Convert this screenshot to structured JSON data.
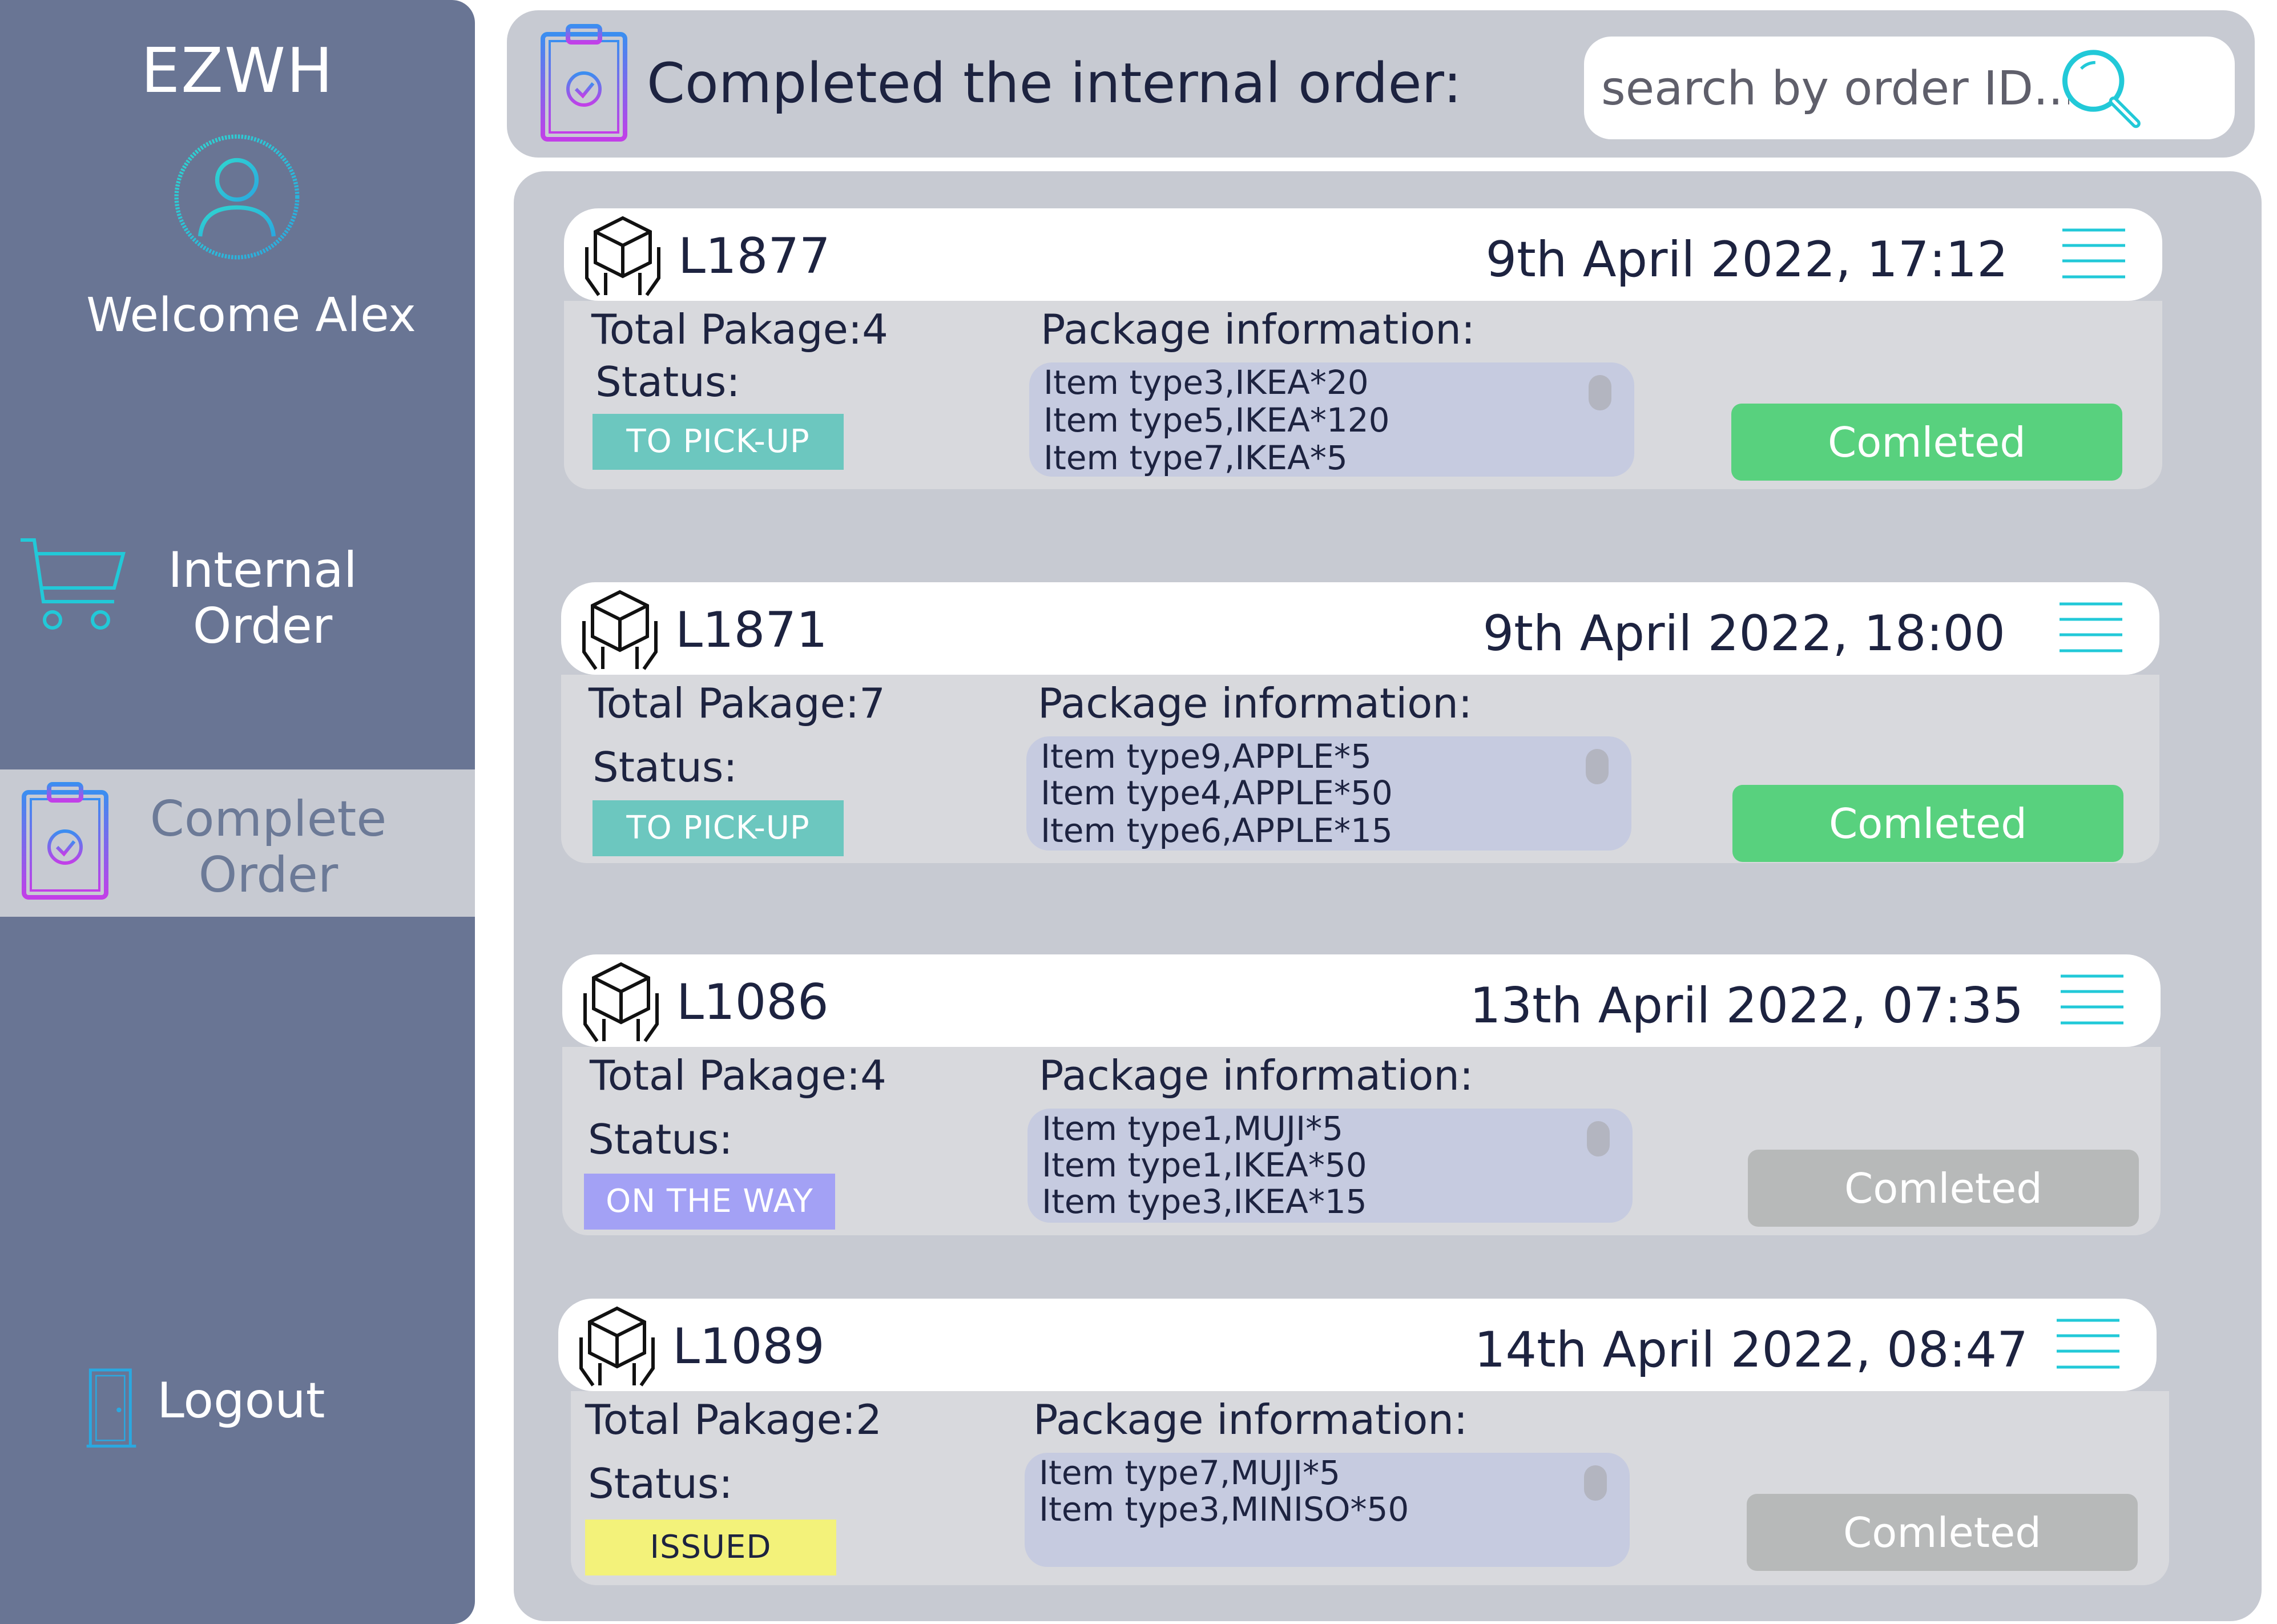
{
  "sidebar": {
    "brand": "EZWH",
    "welcome": "Welcome Alex",
    "avatar_icon": "user-circle-icon",
    "nav": {
      "internal": {
        "label": "Internal\nOrder",
        "icon": "cart-icon"
      },
      "complete": {
        "label": "Complete\nOrder",
        "icon": "clipboard-check-icon"
      },
      "logout": {
        "label": "Logout",
        "icon": "door-icon"
      }
    }
  },
  "header": {
    "title": "Completed the internal order:",
    "icon": "clipboard-check-icon",
    "search_placeholder": "search by order ID..."
  },
  "colors": {
    "sidebar": "#697594",
    "panel": "#c7cad2",
    "accent_cyan": "#22c9d8",
    "accent_purple": "#9b4fe6",
    "to_pickup": "#6cc7bf",
    "on_the_way": "#a3a1f5",
    "issued": "#f3f27a",
    "completed_active": "#58d17e",
    "completed_disabled": "#b7b9b9"
  },
  "orders": [
    {
      "id": "L1877",
      "date": "9th April 2022, 17:12",
      "total": "Total Pakage:4",
      "status_label": "Status:",
      "status": "TO PICK-UP",
      "pkg_title": "Package information:",
      "items": [
        "Item type3,IKEA*20",
        "Item type5,IKEA*120",
        "Item type7,IKEA*5"
      ],
      "button": "Comleted"
    },
    {
      "id": "L1871",
      "date": "9th April 2022, 18:00",
      "total": "Total Pakage:7",
      "status_label": "Status:",
      "status": "TO PICK-UP",
      "pkg_title": "Package information:",
      "items": [
        "Item type9,APPLE*5",
        "Item type4,APPLE*50",
        "Item type6,APPLE*15"
      ],
      "button": "Comleted"
    },
    {
      "id": "L1086",
      "date": "13th April 2022, 07:35",
      "total": "Total Pakage:4",
      "status_label": "Status:",
      "status": "ON THE WAY",
      "pkg_title": "Package information:",
      "items": [
        "Item type1,MUJI*5",
        "Item type1,IKEA*50",
        "Item type3,IKEA*15"
      ],
      "button": "Comleted"
    },
    {
      "id": "L1089",
      "date": "14th April 2022, 08:47",
      "total": "Total Pakage:2",
      "status_label": "Status:",
      "status": "ISSUED",
      "pkg_title": "Package information:",
      "items": [
        "Item type7,MUJI*5",
        "Item type3,MINISO*50"
      ],
      "button": "Comleted"
    }
  ]
}
